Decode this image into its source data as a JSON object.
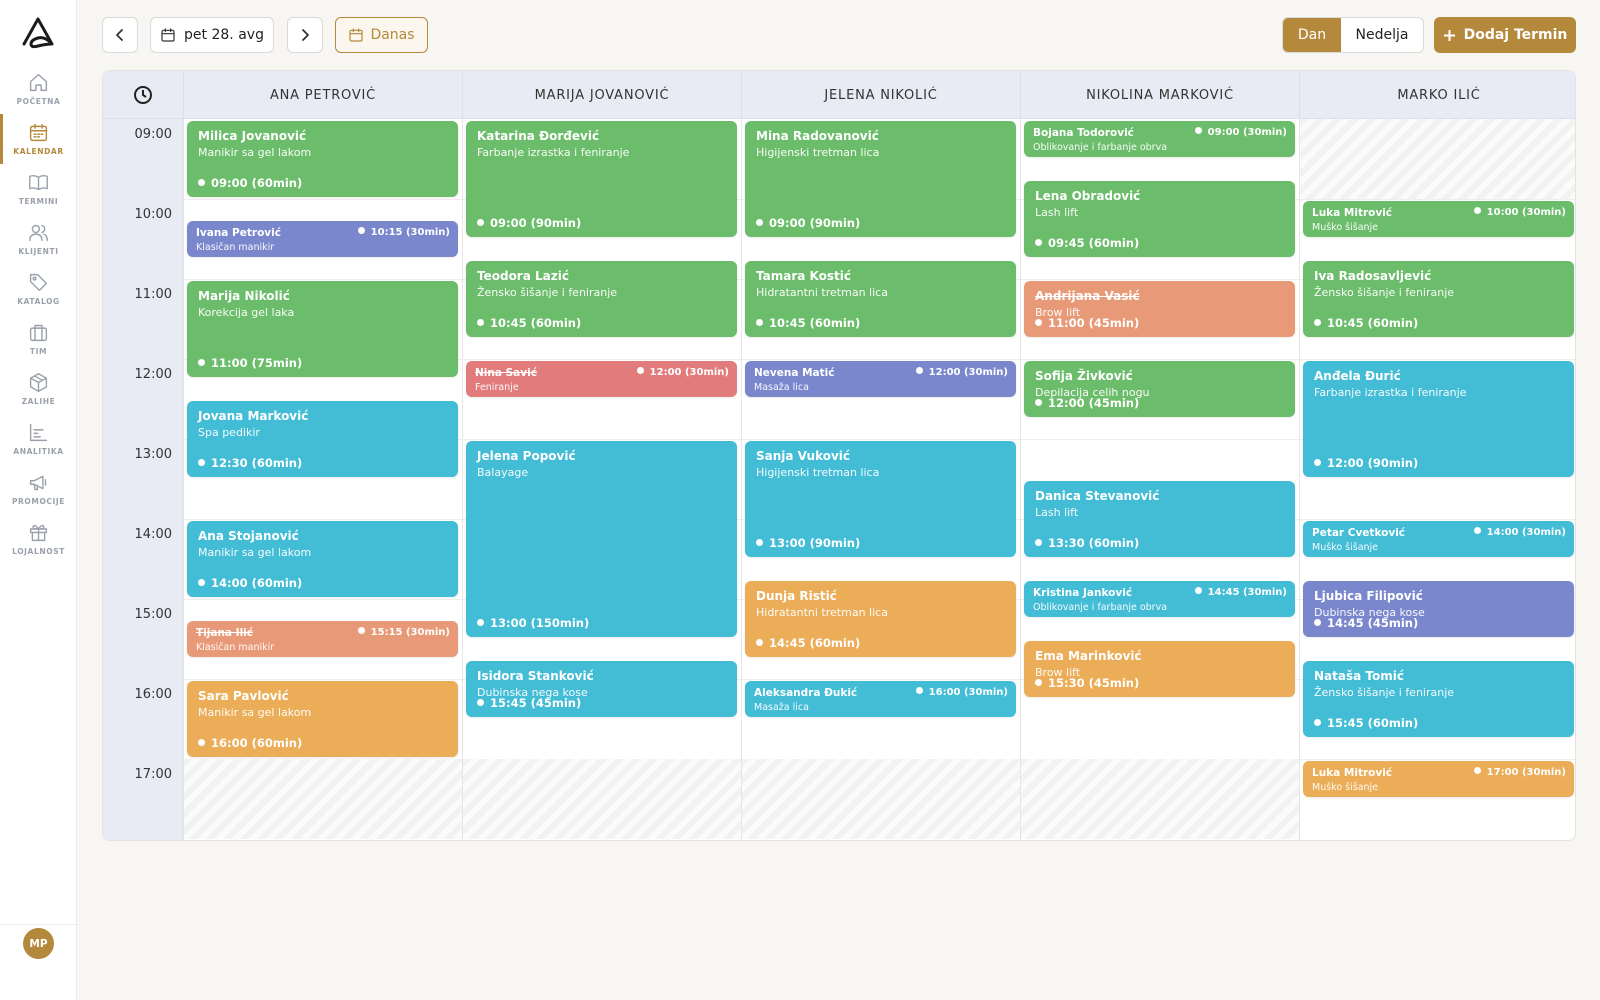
{
  "sidebar": {
    "items": [
      {
        "label": "POČETNA",
        "icon": "home-icon"
      },
      {
        "label": "KALENDAR",
        "icon": "calendar-icon"
      },
      {
        "label": "TERMINI",
        "icon": "book-icon"
      },
      {
        "label": "KLIJENTI",
        "icon": "users-icon"
      },
      {
        "label": "KATALOG",
        "icon": "tag-icon"
      },
      {
        "label": "TIM",
        "icon": "briefcase-icon"
      },
      {
        "label": "ZALIHE",
        "icon": "box-icon"
      },
      {
        "label": "ANALITIKA",
        "icon": "chart-icon"
      },
      {
        "label": "PROMOCIJE",
        "icon": "megaphone-icon"
      },
      {
        "label": "LOJALNOST",
        "icon": "gift-icon"
      }
    ],
    "active_item": "KALENDAR",
    "user_initials": "MP"
  },
  "toolbar": {
    "date_label": "pet 28. avg",
    "today_label": "Danas",
    "view_day": "Dan",
    "view_week": "Nedelja",
    "active_view": "Dan",
    "add_label": "Dodaj Termin"
  },
  "colors": {
    "accent": "#b5893b",
    "green": "#6cbd6b",
    "blue": "#43bcd6",
    "purple": "#7a87cd",
    "orange": "#ebad57",
    "salmon": "#e89a78",
    "red": "#e27c7c"
  },
  "calendar": {
    "hours": [
      "09:00",
      "10:00",
      "11:00",
      "12:00",
      "13:00",
      "14:00",
      "15:00",
      "16:00",
      "17:00"
    ],
    "staff": [
      {
        "name": "ANA PETROVIĆ",
        "appointments": [
          {
            "client": "Milica Jovanović",
            "service": "Manikir sa gel lakom",
            "time": "09:00",
            "duration": "(60min)",
            "color": "green"
          },
          {
            "client": "Ivana Petrović",
            "service": "Klasičan manikir",
            "time": "10:15",
            "duration": "(30min)",
            "color": "purple"
          },
          {
            "client": "Marija Nikolić",
            "service": "Korekcija gel laka",
            "time": "11:00",
            "duration": "(75min)",
            "color": "green"
          },
          {
            "client": "Jovana Marković",
            "service": "Spa pedikir",
            "time": "12:30",
            "duration": "(60min)",
            "color": "blue"
          },
          {
            "client": "Ana Stojanović",
            "service": "Manikir sa gel lakom",
            "time": "14:00",
            "duration": "(60min)",
            "color": "blue"
          },
          {
            "client": "Tijana Ilić",
            "service": "Klasičan manikir",
            "time": "15:15",
            "duration": "(30min)",
            "color": "salmon",
            "cancelled": true
          },
          {
            "client": "Sara Pavlović",
            "service": "Manikir sa gel lakom",
            "time": "16:00",
            "duration": "(60min)",
            "color": "orange"
          }
        ]
      },
      {
        "name": "MARIJA JOVANOVIĆ",
        "appointments": [
          {
            "client": "Katarina Đorđević",
            "service": "Farbanje izrastka i feniranje",
            "time": "09:00",
            "duration": "(90min)",
            "color": "green"
          },
          {
            "client": "Teodora Lazić",
            "service": "Žensko šišanje i feniranje",
            "time": "10:45",
            "duration": "(60min)",
            "color": "green"
          },
          {
            "client": "Nina Savić",
            "service": "Feniranje",
            "time": "12:00",
            "duration": "(30min)",
            "color": "red",
            "cancelled": true
          },
          {
            "client": "Jelena Popović",
            "service": "Balayage",
            "time": "13:00",
            "duration": "(150min)",
            "color": "blue"
          },
          {
            "client": "Isidora Stanković",
            "service": "Dubinska nega kose",
            "time": "15:45",
            "duration": "(45min)",
            "color": "blue"
          }
        ]
      },
      {
        "name": "JELENA NIKOLIĆ",
        "appointments": [
          {
            "client": "Mina Radovanović",
            "service": "Higijenski tretman lica",
            "time": "09:00",
            "duration": "(90min)",
            "color": "green"
          },
          {
            "client": "Tamara Kostić",
            "service": "Hidratantni tretman lica",
            "time": "10:45",
            "duration": "(60min)",
            "color": "green"
          },
          {
            "client": "Nevena Matić",
            "service": "Masaža lica",
            "time": "12:00",
            "duration": "(30min)",
            "color": "purple"
          },
          {
            "client": "Sanja Vuković",
            "service": "Higijenski tretman lica",
            "time": "13:00",
            "duration": "(90min)",
            "color": "blue"
          },
          {
            "client": "Dunja Ristić",
            "service": "Hidratantni tretman lica",
            "time": "14:45",
            "duration": "(60min)",
            "color": "orange"
          },
          {
            "client": "Aleksandra Đukić",
            "service": "Masaža lica",
            "time": "16:00",
            "duration": "(30min)",
            "color": "blue"
          }
        ]
      },
      {
        "name": "NIKOLINA MARKOVIĆ",
        "appointments": [
          {
            "client": "Bojana Todorović",
            "service": "Oblikovanje i farbanje obrva",
            "time": "09:00",
            "duration": "(30min)",
            "color": "green"
          },
          {
            "client": "Lena Obradović",
            "service": "Lash lift",
            "time": "09:45",
            "duration": "(60min)",
            "color": "green"
          },
          {
            "client": "Andrijana Vasić",
            "service": "Brow lift",
            "time": "11:00",
            "duration": "(45min)",
            "color": "salmon",
            "cancelled": true
          },
          {
            "client": "Sofija Živković",
            "service": "Depilacija celih nogu",
            "time": "12:00",
            "duration": "(45min)",
            "color": "green"
          },
          {
            "client": "Danica Stevanović",
            "service": "Lash lift",
            "time": "13:30",
            "duration": "(60min)",
            "color": "blue"
          },
          {
            "client": "Kristina Janković",
            "service": "Oblikovanje i farbanje obrva",
            "time": "14:45",
            "duration": "(30min)",
            "color": "blue"
          },
          {
            "client": "Ema Marinković",
            "service": "Brow lift",
            "time": "15:30",
            "duration": "(45min)",
            "color": "orange"
          }
        ]
      },
      {
        "name": "MARKO ILIĆ",
        "appointments": [
          {
            "client": "Luka Mitrović",
            "service": "Muško šišanje",
            "time": "10:00",
            "duration": "(30min)",
            "color": "green"
          },
          {
            "client": "Iva Radosavljević",
            "service": "Žensko šišanje i feniranje",
            "time": "10:45",
            "duration": "(60min)",
            "color": "green"
          },
          {
            "client": "Anđela Đurić",
            "service": "Farbanje izrastka i feniranje",
            "time": "12:00",
            "duration": "(90min)",
            "color": "blue"
          },
          {
            "client": "Petar Cvetković",
            "service": "Muško šišanje",
            "time": "14:00",
            "duration": "(30min)",
            "color": "blue"
          },
          {
            "client": "Ljubica Filipović",
            "service": "Dubinska nega kose",
            "time": "14:45",
            "duration": "(45min)",
            "color": "purple"
          },
          {
            "client": "Nataša Tomić",
            "service": "Žensko šišanje i feniranje",
            "time": "15:45",
            "duration": "(60min)",
            "color": "blue"
          },
          {
            "client": "Luka Mitrović",
            "service": "Muško šišanje",
            "time": "17:00",
            "duration": "(30min)",
            "color": "orange"
          }
        ]
      }
    ]
  }
}
